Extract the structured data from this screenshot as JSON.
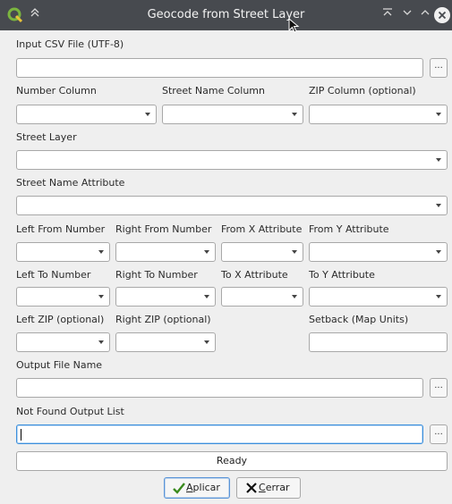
{
  "window": {
    "title": "Geocode from Street Layer"
  },
  "labels": {
    "input_csv": "Input CSV File (UTF-8)",
    "number_column": "Number Column",
    "street_name_column": "Street Name Column",
    "zip_column": "ZIP Column (optional)",
    "street_layer": "Street Layer",
    "street_name_attribute": "Street Name Attribute",
    "left_from_number": "Left From Number",
    "right_from_number": "Right From Number",
    "from_x_attribute": "From X Attribute",
    "from_y_attribute": "From Y Attribute",
    "left_to_number": "Left To Number",
    "right_to_number": "Right To Number",
    "to_x_attribute": "To X Attribute",
    "to_y_attribute": "To Y Attribute",
    "left_zip": "Left ZIP (optional)",
    "right_zip": "Right ZIP (optional)",
    "setback": "Setback (Map Units)",
    "output_file_name": "Output File Name",
    "not_found_output_list": "Not Found Output List"
  },
  "values": {
    "input_csv": "",
    "setback": "",
    "output_file_name": "",
    "not_found_output_list": ""
  },
  "browse_label": "...",
  "status": "Ready",
  "buttons": {
    "apply_prefix": "A",
    "apply_rest": "plicar",
    "close_prefix": "C",
    "close_rest": "errar"
  },
  "colors": {
    "titlebar": "#474a4f",
    "dialog_bg": "#efefef",
    "focus": "#3b8fdc",
    "qgis_green": "#7bb53f"
  }
}
